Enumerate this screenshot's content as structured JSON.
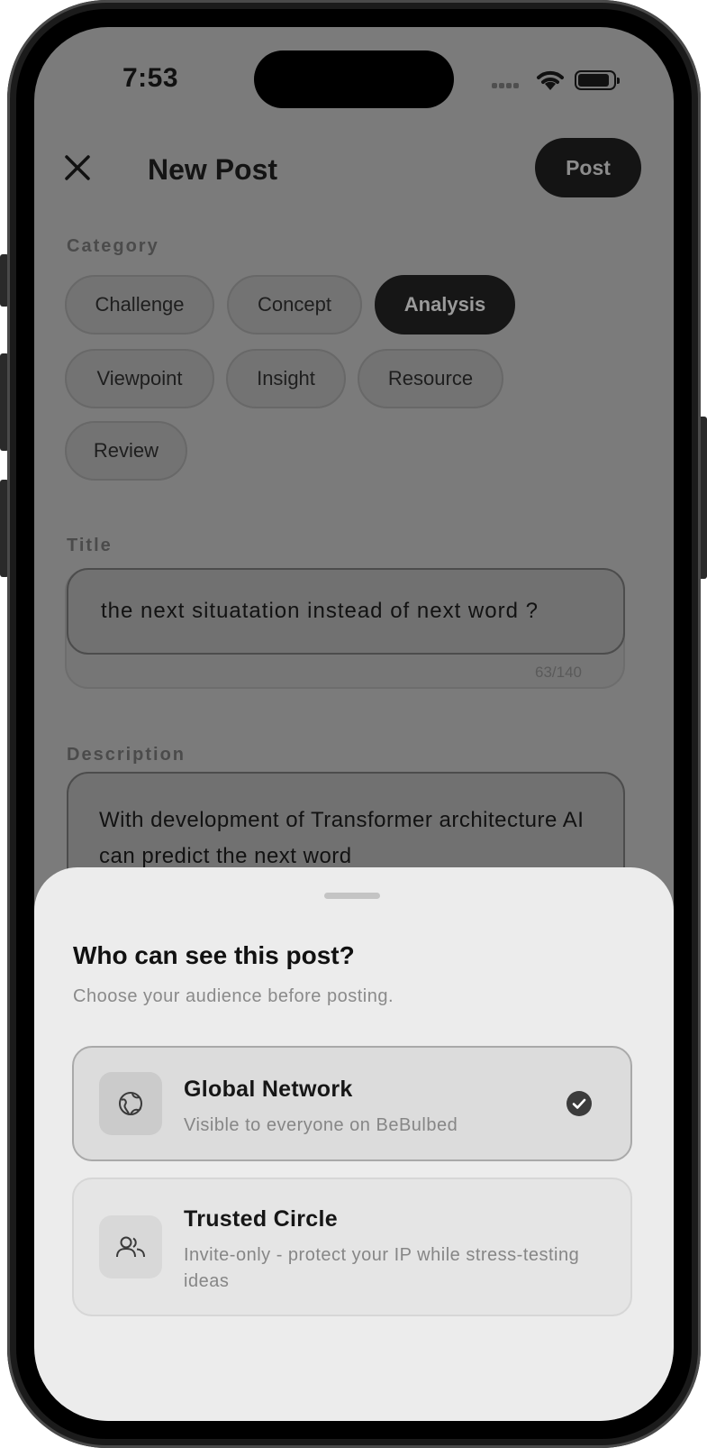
{
  "status_bar": {
    "time": "7:53"
  },
  "header": {
    "title": "New Post",
    "post_label": "Post"
  },
  "category": {
    "label": "Category",
    "chips": [
      "Challenge",
      "Concept",
      "Analysis",
      "Viewpoint",
      "Insight",
      "Resource",
      "Review"
    ],
    "selected": "Analysis"
  },
  "title_field": {
    "label": "Title",
    "value": "the next situatation instead of next word ?",
    "count": "63/140"
  },
  "description_field": {
    "label": "Description",
    "value": "With development of Transformer architecture AI can predict the next word"
  },
  "audience_sheet": {
    "title": "Who can see this post?",
    "subtitle": "Choose your audience before posting.",
    "options": [
      {
        "title": "Global Network",
        "description": "Visible to everyone on BeBulbed",
        "icon": "globe-icon",
        "selected": true
      },
      {
        "title": "Trusted Circle",
        "description": "Invite-only - protect your IP while stress-testing ideas",
        "icon": "users-icon",
        "selected": false
      }
    ]
  }
}
